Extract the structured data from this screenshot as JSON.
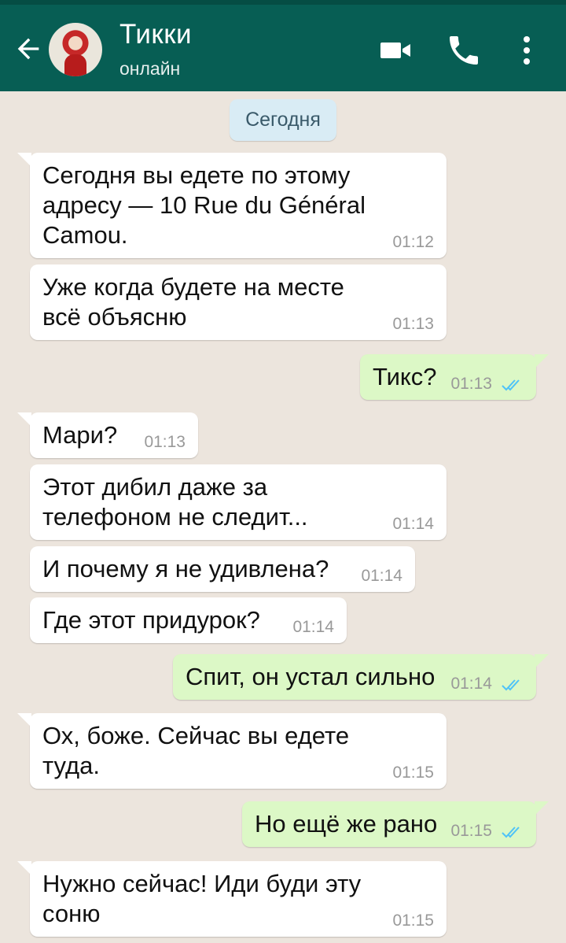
{
  "header": {
    "contact_name": "Тикки",
    "status": "онлайн",
    "bg_color": "#075E54"
  },
  "chat": {
    "day_label": "Сегодня",
    "messages": [
      {
        "dir": "in",
        "text": "Сегодня вы едете по этому\nадресу — 10 Rue du Général\nCamou.",
        "time": "01:12"
      },
      {
        "dir": "in",
        "text": "Уже когда будете на месте\nвсё объясню",
        "time": "01:13"
      },
      {
        "dir": "out",
        "text": "Тикс?",
        "time": "01:13",
        "status": "read"
      },
      {
        "dir": "in",
        "text": "Мари?",
        "time": "01:13"
      },
      {
        "dir": "in",
        "text": "Этот дибил даже за\nтелефоном не следит...",
        "time": "01:14"
      },
      {
        "dir": "in",
        "text": "И почему я не удивлена?",
        "time": "01:14"
      },
      {
        "dir": "in",
        "text": "Где этот придурок?",
        "time": "01:14"
      },
      {
        "dir": "out",
        "text": "Спит, он устал сильно",
        "time": "01:14",
        "status": "read"
      },
      {
        "dir": "in",
        "text": " Ох, боже. Сейчас вы едете\nтуда.",
        "time": "01:15"
      },
      {
        "dir": "out",
        "text": "Но ещё же рано",
        "time": "01:15",
        "status": "read"
      },
      {
        "dir": "in",
        "text": "Нужно сейчас! Иди буди эту\nсоню",
        "time": "01:15"
      }
    ]
  },
  "icons": {
    "back": "arrow-left-icon",
    "video": "video-call-icon",
    "call": "phone-icon",
    "menu": "more-vert-icon",
    "read": "double-check-icon"
  },
  "colors": {
    "outgoing_bubble": "#DCF8C6",
    "incoming_bubble": "#FFFFFF",
    "read_ticks": "#4FC3F7"
  }
}
